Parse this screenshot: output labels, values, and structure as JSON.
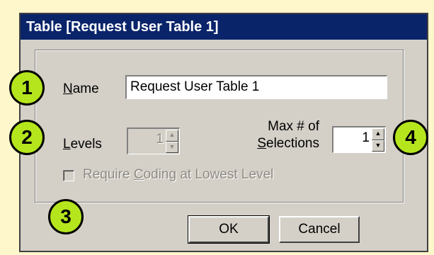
{
  "window": {
    "title": "Table [Request User Table 1]"
  },
  "form": {
    "name_label_mnemonic": "N",
    "name_label_rest": "ame",
    "name_value": "Request User Table 1",
    "levels_label_mnemonic": "L",
    "levels_label_rest": "evels",
    "levels_value": "1",
    "max_label_line1": "Max # of",
    "max_label_mnemonic": "S",
    "max_label_rest": "elections",
    "max_value": "1",
    "require_coding_pre": "Require ",
    "require_coding_mnemonic": "C",
    "require_coding_rest": "oding at Lowest Level"
  },
  "buttons": {
    "ok": "OK",
    "cancel": "Cancel"
  },
  "callouts": [
    "1",
    "2",
    "3",
    "4"
  ],
  "colors": {
    "background": "#FFF7CC",
    "titlebar": "#0A246A",
    "callout": "#B5E61D"
  }
}
